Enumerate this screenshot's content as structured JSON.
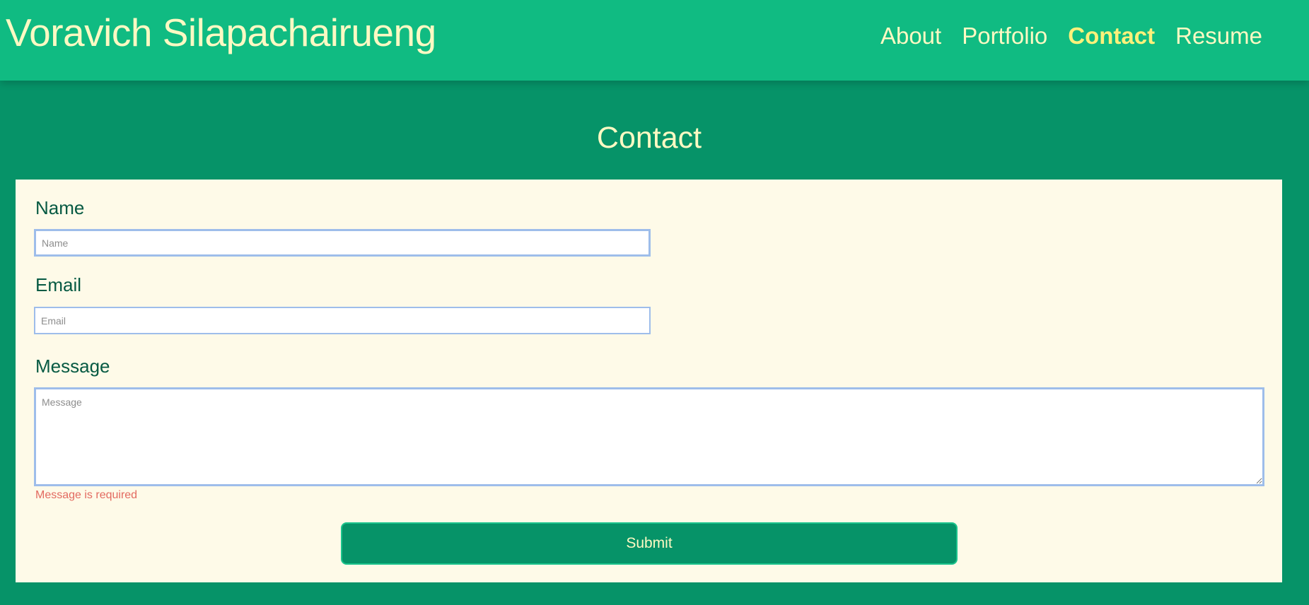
{
  "header": {
    "site_title": "Voravich Silapachairueng",
    "nav": [
      {
        "label": "About",
        "active": false
      },
      {
        "label": "Portfolio",
        "active": false
      },
      {
        "label": "Contact",
        "active": true
      },
      {
        "label": "Resume",
        "active": false
      }
    ]
  },
  "main": {
    "heading": "Contact",
    "form": {
      "name_label": "Name",
      "name_placeholder": "Name",
      "name_value": "",
      "email_label": "Email",
      "email_placeholder": "Email",
      "email_value": "",
      "message_label": "Message",
      "message_placeholder": "Message",
      "message_value": "",
      "message_error": "Message is required",
      "submit_label": "Submit"
    }
  },
  "colors": {
    "header_bg": "#10bb82",
    "page_bg": "#069368",
    "card_bg": "#fefae8",
    "title_text": "#fdf9c3",
    "active_nav": "#fff17a",
    "label_text": "#075a43",
    "error_text": "#e36a60",
    "input_border": "#9ebdea"
  }
}
